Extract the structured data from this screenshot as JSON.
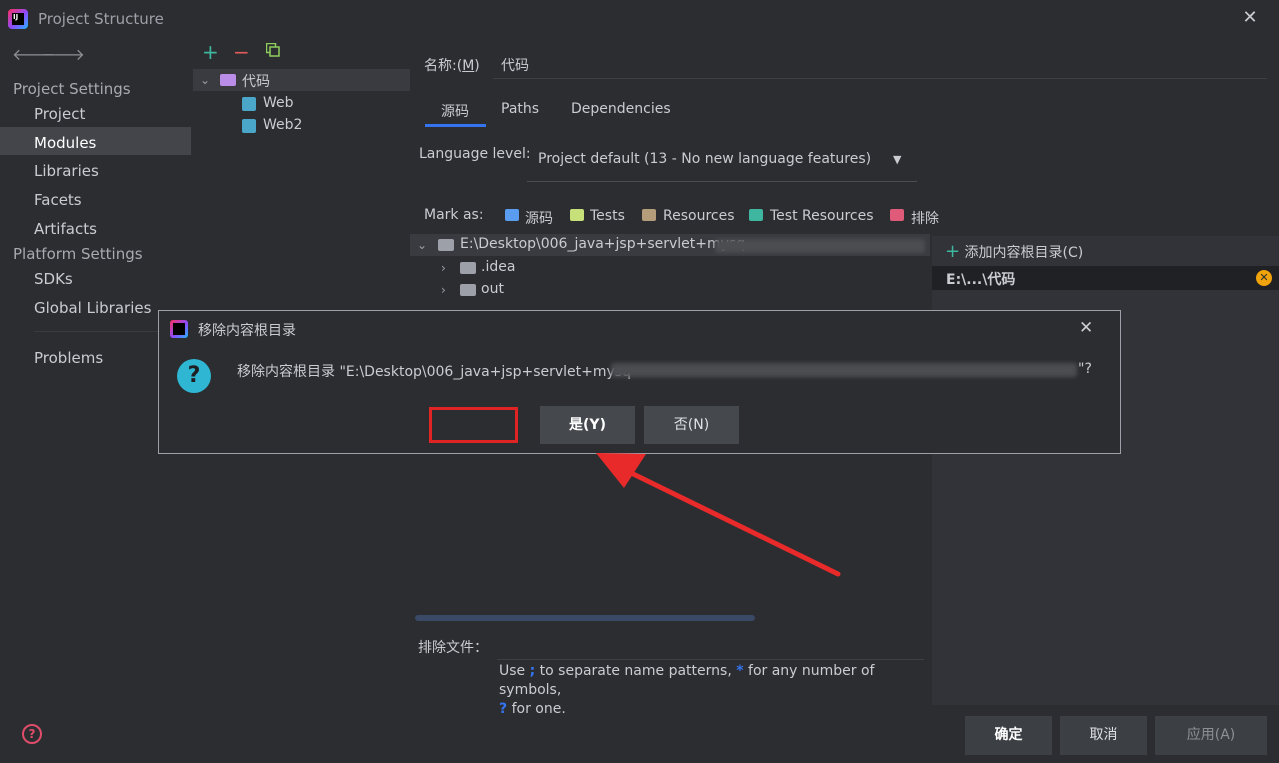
{
  "window": {
    "title": "Project Structure"
  },
  "nav": {
    "back_icon": "arrow-left-icon",
    "forward_icon": "arrow-right-icon",
    "project_settings": "Project Settings",
    "project_items": [
      "Project",
      "Modules",
      "Libraries",
      "Facets",
      "Artifacts"
    ],
    "selected": "Modules",
    "platform_settings": "Platform Settings",
    "platform_items": [
      "SDKs",
      "Global Libraries"
    ],
    "problems": "Problems"
  },
  "modules_tree": {
    "root": "代码",
    "children": [
      "Web",
      "Web2"
    ]
  },
  "module": {
    "name_label_prefix": "名称:(",
    "name_label_key": "M",
    "name_label_suffix": ")",
    "name_value": "代码",
    "tabs": [
      "源码",
      "Paths",
      "Dependencies"
    ],
    "language_level_label": "Language level:",
    "language_level_value": "Project default (13 - No new language features)",
    "mark_as_label": "Mark as:",
    "mark_as": [
      {
        "label": "源码",
        "color": "#5a9cf0"
      },
      {
        "label": "Tests",
        "color": "#8fce5e"
      },
      {
        "label": "Resources",
        "color": "#b59d7c"
      },
      {
        "label": "Test Resources",
        "color": "#3fb6a0"
      },
      {
        "label": "排除",
        "color": "#e05a7a"
      }
    ],
    "content_root_path": "E:\\Desktop\\006_java+jsp+servlet+mysq",
    "content_folders": [
      ".idea",
      "out"
    ],
    "add_content_root": "添加内容根目录(C)",
    "root_entry": "E:\\...\\代码",
    "exclude_files_label": "排除文件：",
    "hint_part1": "Use ",
    "hint_semicolon": ";",
    "hint_part2": " to separate name patterns, ",
    "hint_star": "*",
    "hint_part3": " for any number of symbols,",
    "hint_question": "?",
    "hint_part4": " for one."
  },
  "dialog": {
    "title": "移除内容根目录",
    "message": "移除内容根目录 \"E:\\Desktop\\006_java+jsp+servlet+mysq",
    "message_end": "\"?",
    "yes_button": "是(Y)",
    "no_button": "否(N)"
  },
  "footer": {
    "ok": "确定",
    "cancel": "取消",
    "apply": "应用(A)"
  }
}
